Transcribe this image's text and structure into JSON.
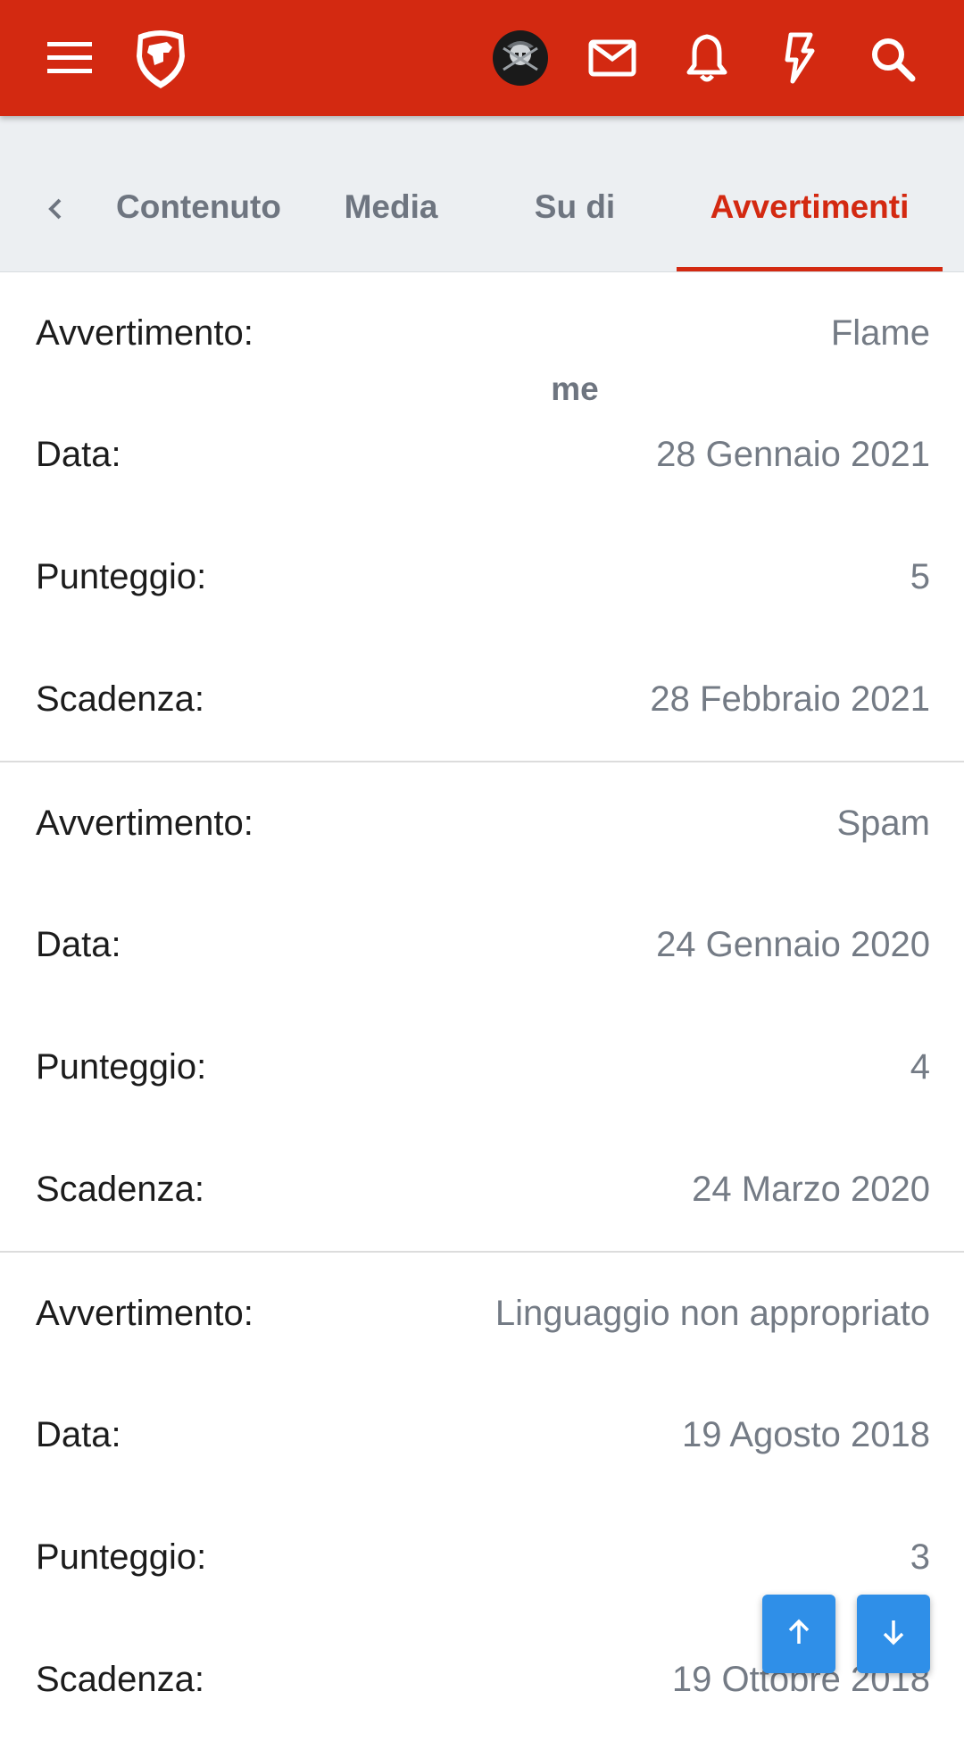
{
  "header": {
    "icons": [
      "menu-icon",
      "site-logo",
      "avatar",
      "mail-icon",
      "bell-icon",
      "lightning-icon",
      "search-icon"
    ],
    "accent_color": "#d32911"
  },
  "tabs": {
    "items": [
      {
        "label": "Contenuto",
        "active": false
      },
      {
        "label": "Media",
        "active": false
      },
      {
        "label": "Su di me",
        "active": false
      },
      {
        "label": "Avvertimenti",
        "active": true
      }
    ]
  },
  "warnings": [
    {
      "rows": [
        {
          "label": "Avvertimento:",
          "value": "Flame"
        },
        {
          "label": "Data:",
          "value": "28 Gennaio 2021"
        },
        {
          "label": "Punteggio:",
          "value": "5"
        },
        {
          "label": "Scadenza:",
          "value": "28 Febbraio 2021"
        }
      ]
    },
    {
      "rows": [
        {
          "label": "Avvertimento:",
          "value": "Spam"
        },
        {
          "label": "Data:",
          "value": "24 Gennaio 2020"
        },
        {
          "label": "Punteggio:",
          "value": "4"
        },
        {
          "label": "Scadenza:",
          "value": "24 Marzo 2020"
        }
      ]
    },
    {
      "rows": [
        {
          "label": "Avvertimento:",
          "value": "Linguaggio non appropriato"
        },
        {
          "label": "Data:",
          "value": "19 Agosto 2018"
        },
        {
          "label": "Punteggio:",
          "value": "3"
        },
        {
          "label": "Scadenza:",
          "value": "19 Ottobre 2018"
        }
      ]
    }
  ],
  "fab": {
    "up_icon": "arrow-up-icon",
    "down_icon": "arrow-down-icon",
    "color": "#2f8fe8"
  }
}
